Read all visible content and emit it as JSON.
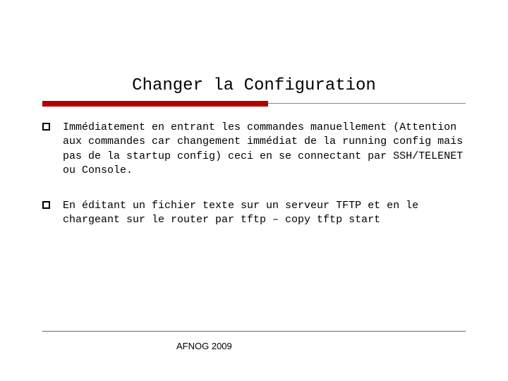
{
  "title": "Changer la Configuration",
  "bullets": [
    {
      "text": "Immédiatement en entrant les commandes manuellement (Attention aux commandes car changement immédiat de la running config mais pas de la startup config) ceci en se connectant par SSH/TELENET ou Console."
    },
    {
      "text": "En éditant un fichier texte sur un serveur TFTP et en le chargeant sur le router par tftp – copy tftp start"
    }
  ],
  "footer": "AFNOG 2009"
}
